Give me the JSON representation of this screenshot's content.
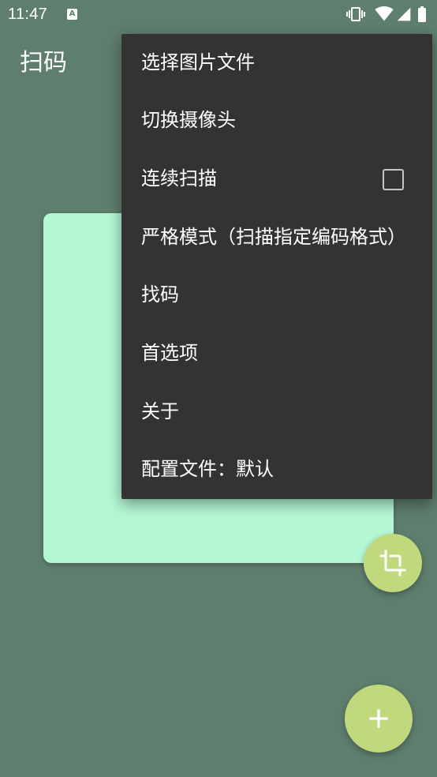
{
  "status_bar": {
    "time": "11:47",
    "notification_icon": {
      "name": "input-method-icon",
      "glyph": "A"
    },
    "icons": [
      "vibrate-icon",
      "wifi-icon",
      "signal-icon",
      "battery-icon"
    ]
  },
  "app_bar": {
    "title": "扫码"
  },
  "overflow_menu": {
    "items": [
      {
        "label": "选择图片文件"
      },
      {
        "label": "切换摄像头"
      },
      {
        "label": "连续扫描",
        "checkbox": true,
        "checked": false
      },
      {
        "label": "严格模式（扫描指定编码格式）"
      },
      {
        "label": "找码"
      },
      {
        "label": "首选项"
      },
      {
        "label": "关于"
      },
      {
        "label": "配置文件：默认"
      }
    ]
  },
  "fabs": {
    "crop": {
      "icon": "crop-icon"
    },
    "add": {
      "icon": "add-icon"
    }
  },
  "colors": {
    "background": "#5e7e6e",
    "card": "#b3f7d3",
    "menu": "#333333",
    "fab": "#bfd97c",
    "text_on_dark": "#ffffff",
    "checkbox_border": "#c4c4c4"
  }
}
